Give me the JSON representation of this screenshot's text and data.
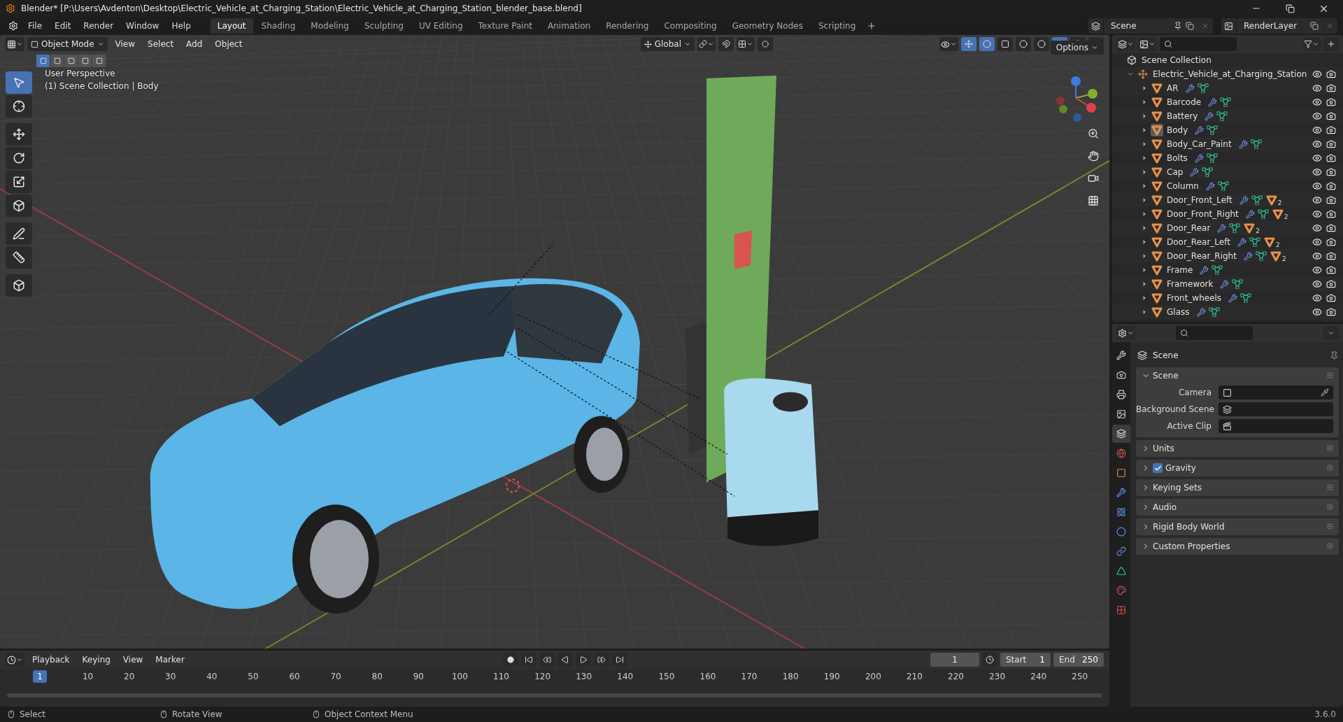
{
  "window": {
    "title": "Blender* [P:\\Users\\Avdenton\\Desktop\\Electric_Vehicle_at_Charging_Station\\Electric_Vehicle_at_Charging_Station_blender_base.blend]"
  },
  "menu": [
    "File",
    "Edit",
    "Render",
    "Window",
    "Help"
  ],
  "workspaces": [
    {
      "label": "Layout",
      "selected": true
    },
    {
      "label": "Shading",
      "selected": false
    },
    {
      "label": "Modeling",
      "selected": false
    },
    {
      "label": "Sculpting",
      "selected": false
    },
    {
      "label": "UV Editing",
      "selected": false
    },
    {
      "label": "Texture Paint",
      "selected": false
    },
    {
      "label": "Animation",
      "selected": false
    },
    {
      "label": "Rendering",
      "selected": false
    },
    {
      "label": "Compositing",
      "selected": false
    },
    {
      "label": "Geometry Nodes",
      "selected": false
    },
    {
      "label": "Scripting",
      "selected": false
    }
  ],
  "scene": {
    "value": "Scene"
  },
  "view_layer": {
    "value": "RenderLayer"
  },
  "viewport": {
    "mode": "Object Mode",
    "menus": [
      "View",
      "Select",
      "Add",
      "Object"
    ],
    "orientation": "Global",
    "options": "Options",
    "perspective": "User Perspective",
    "context": "(1) Scene Collection | Body",
    "tools": [
      {
        "selected": true
      },
      {
        "selected": false
      },
      {
        "selected": false
      },
      {
        "selected": false
      },
      {
        "selected": false
      },
      {
        "selected": false
      },
      {
        "selected": false
      },
      {
        "selected": false
      },
      {
        "selected": false
      }
    ],
    "shading": [
      {
        "selected": false
      },
      {
        "selected": false
      },
      {
        "selected": true
      },
      {
        "selected": false
      }
    ]
  },
  "outliner": {
    "root": "Scene Collection",
    "collection": {
      "name": "Electric_Vehicle_at_Charging_Station",
      "expanded": true,
      "children": [
        {
          "name": "AR",
          "active": false
        },
        {
          "name": "Barcode",
          "active": false
        },
        {
          "name": "Battery",
          "active": false
        },
        {
          "name": "Body",
          "active": true
        },
        {
          "name": "Body_Car_Paint",
          "active": false
        },
        {
          "name": "Bolts",
          "active": false
        },
        {
          "name": "Cap",
          "active": false
        },
        {
          "name": "Column",
          "active": false
        },
        {
          "name": "Door_Front_Left",
          "active": false,
          "materials": "2"
        },
        {
          "name": "Door_Front_Right",
          "active": false,
          "materials": "2"
        },
        {
          "name": "Door_Rear",
          "active": false,
          "materials": "2"
        },
        {
          "name": "Door_Rear_Left",
          "active": false,
          "materials": "2"
        },
        {
          "name": "Door_Rear_Right",
          "active": false,
          "materials": "2"
        },
        {
          "name": "Frame",
          "active": false
        },
        {
          "name": "Framework",
          "active": false
        },
        {
          "name": "Front_wheels",
          "active": false
        },
        {
          "name": "Glass",
          "active": false
        }
      ]
    }
  },
  "properties": {
    "tabs": [
      {
        "selected": false
      },
      {
        "selected": false
      },
      {
        "selected": false
      },
      {
        "selected": false
      },
      {
        "selected": true
      },
      {
        "selected": false
      },
      {
        "selected": false
      },
      {
        "selected": false
      },
      {
        "selected": false
      },
      {
        "selected": false
      },
      {
        "selected": false
      },
      {
        "selected": false
      },
      {
        "selected": false
      },
      {
        "selected": false
      }
    ],
    "title": "Scene",
    "panels": [
      {
        "title": "Scene",
        "expanded": true,
        "kind": "plain",
        "fields": [
          {
            "label": "Camera",
            "kind": "camera"
          },
          {
            "label": "Background Scene",
            "kind": "scene"
          },
          {
            "label": "Active Clip",
            "kind": "clip"
          }
        ]
      },
      {
        "title": "Units",
        "expanded": false,
        "kind": "plain"
      },
      {
        "title": "Gravity",
        "expanded": false,
        "kind": "checkbox",
        "checked": true
      },
      {
        "title": "Keying Sets",
        "expanded": false,
        "kind": "plain"
      },
      {
        "title": "Audio",
        "expanded": false,
        "kind": "plain"
      },
      {
        "title": "Rigid Body World",
        "expanded": false,
        "kind": "plain"
      },
      {
        "title": "Custom Properties",
        "expanded": false,
        "kind": "plain"
      }
    ]
  },
  "timeline": {
    "menus": [
      "Playback",
      "Keying",
      "View",
      "Marker"
    ],
    "current_frame": "1",
    "start_label": "Start",
    "start": "1",
    "end_label": "End",
    "end": "250",
    "playhead": "1",
    "ruler": [
      "10",
      "20",
      "30",
      "40",
      "50",
      "60",
      "70",
      "80",
      "90",
      "100",
      "110",
      "120",
      "130",
      "140",
      "150",
      "160",
      "170",
      "180",
      "190",
      "200",
      "210",
      "220",
      "230",
      "240",
      "250"
    ]
  },
  "status_bar": {
    "items": [
      "Select",
      "Rotate View",
      "Object Context Menu"
    ],
    "version": "3.6.0"
  }
}
